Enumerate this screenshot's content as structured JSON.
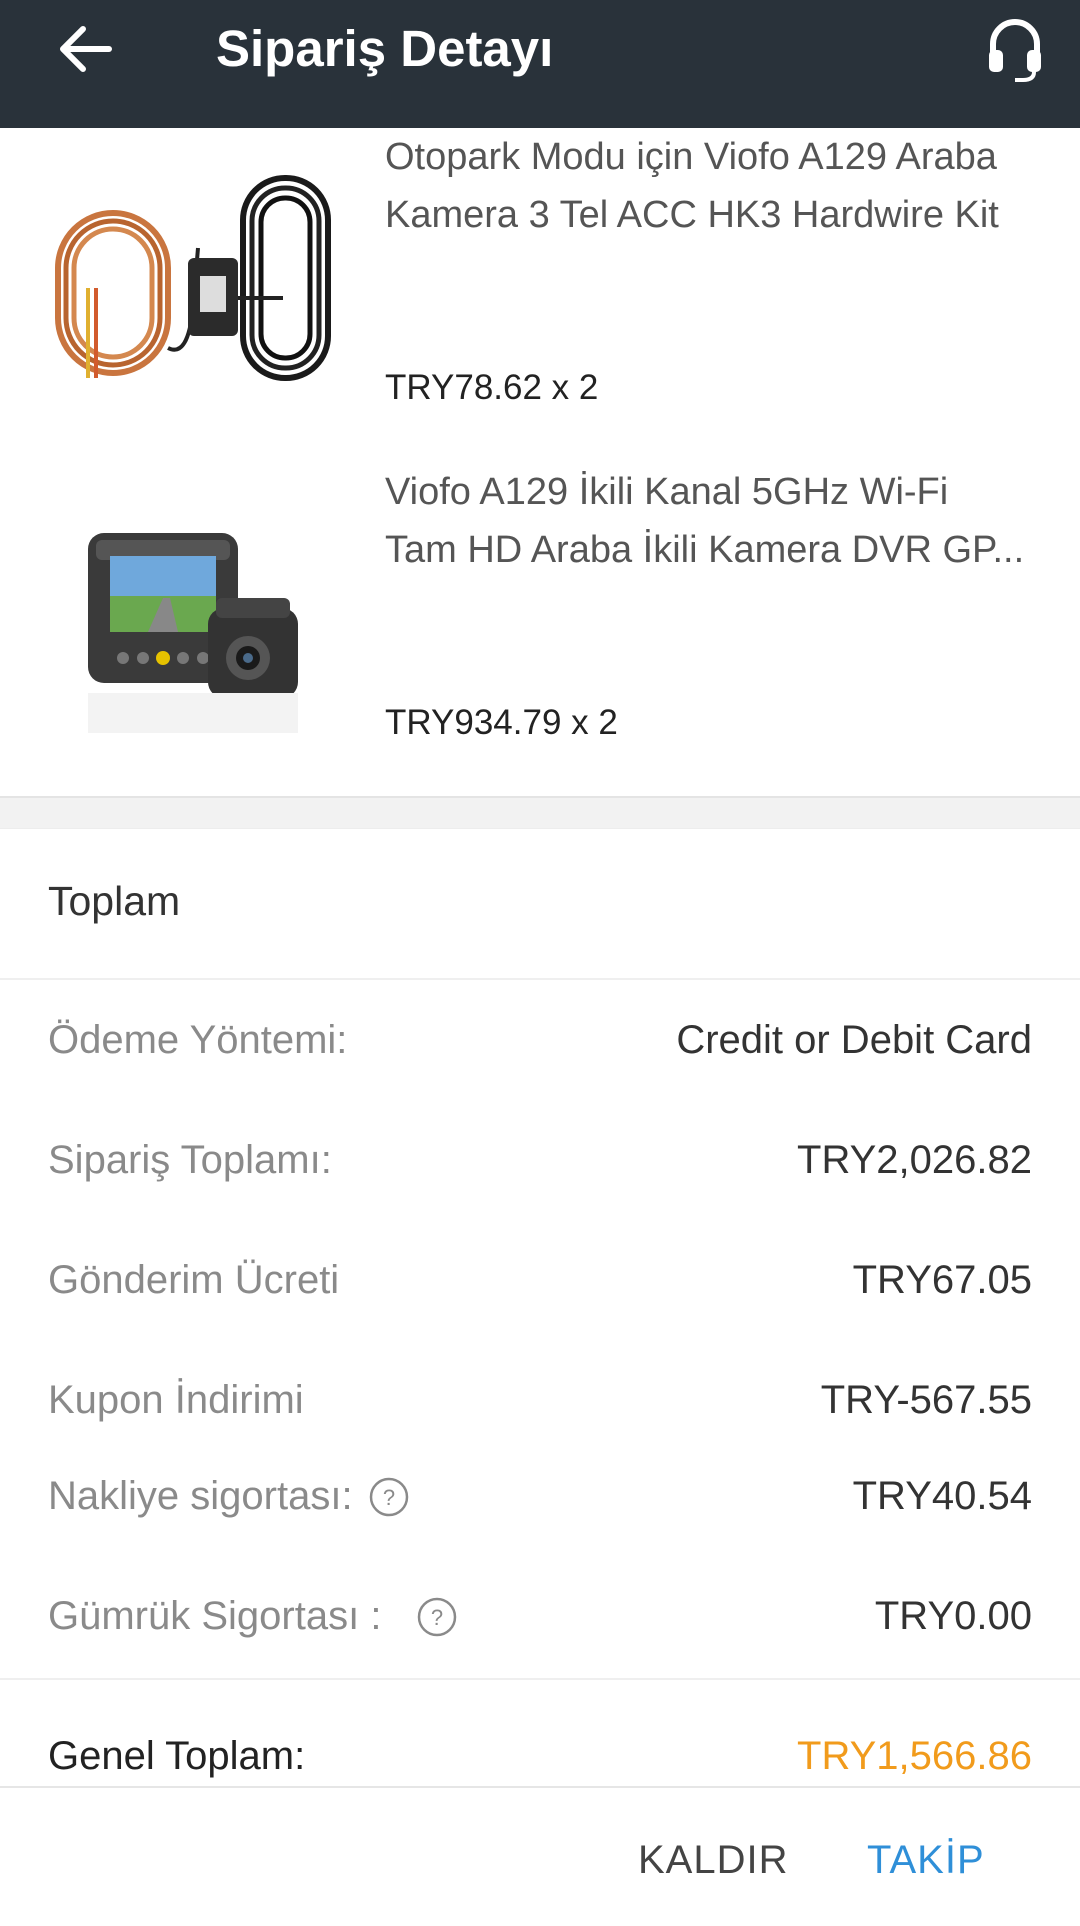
{
  "header": {
    "title": "Sipariş Detayı",
    "back_icon": "arrow-left-icon",
    "support_icon": "headset-icon"
  },
  "items": [
    {
      "name_line1": "Otopark Modu için Viofo A129 Araba",
      "name_line2": "Kamera 3 Tel ACC HK3 Hardwire Kit",
      "price": "TRY78.62 x 2"
    },
    {
      "name_line1": "Viofo A129 İkili Kanal 5GHz Wi-Fi",
      "name_line2": "Tam HD Araba İkili Kamera DVR GP...",
      "price": "TRY934.79 x 2"
    }
  ],
  "summary": {
    "title": "Toplam",
    "payment_label": "Ödeme Yöntemi:",
    "payment_value": "Credit or Debit Card",
    "order_total_label": "Sipariş Toplamı:",
    "order_total_value": "TRY2,026.82",
    "shipping_label": "Gönderim Ücreti",
    "shipping_value": "TRY67.05",
    "coupon_label": "Kupon İndirimi",
    "coupon_value": "TRY-567.55",
    "shipping_insurance_label": "Nakliye sigortası:",
    "shipping_insurance_value": "TRY40.54",
    "customs_insurance_label": "Gümrük Sigortası :",
    "customs_insurance_value": "TRY0.00",
    "grand_total_label": "Genel Toplam:",
    "grand_total_value": "TRY1,566.86"
  },
  "actions": {
    "remove_label": "KALDIR",
    "track_label": "TAKİP"
  },
  "colors": {
    "header_bg": "#29323a",
    "grand_total": "#f19b1c",
    "track_button": "#2f8fd8"
  }
}
